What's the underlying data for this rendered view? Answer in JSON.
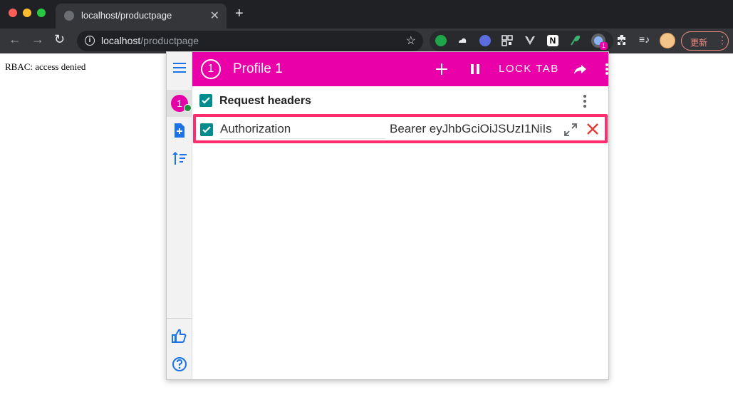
{
  "browser": {
    "tab_title": "localhost/productpage",
    "url_host": "localhost",
    "url_path": "/productpage",
    "update_label": "更新",
    "extension_badge": "1"
  },
  "page": {
    "body_text": "RBAC: access denied"
  },
  "popup": {
    "profile_number": "1",
    "profile_title": "Profile 1",
    "lock_tab_label": "LOCK TAB",
    "section_title": "Request headers",
    "headers": [
      {
        "name": "Authorization",
        "value": "Bearer eyJhbGciOiJSUzI1NiIs",
        "enabled": true
      }
    ]
  },
  "colors": {
    "accent": "#e900a8",
    "checkbox": "#008c8c",
    "highlight": "#ff2d6e",
    "delete": "#e53935",
    "sidebar_icon": "#1a73e8"
  }
}
